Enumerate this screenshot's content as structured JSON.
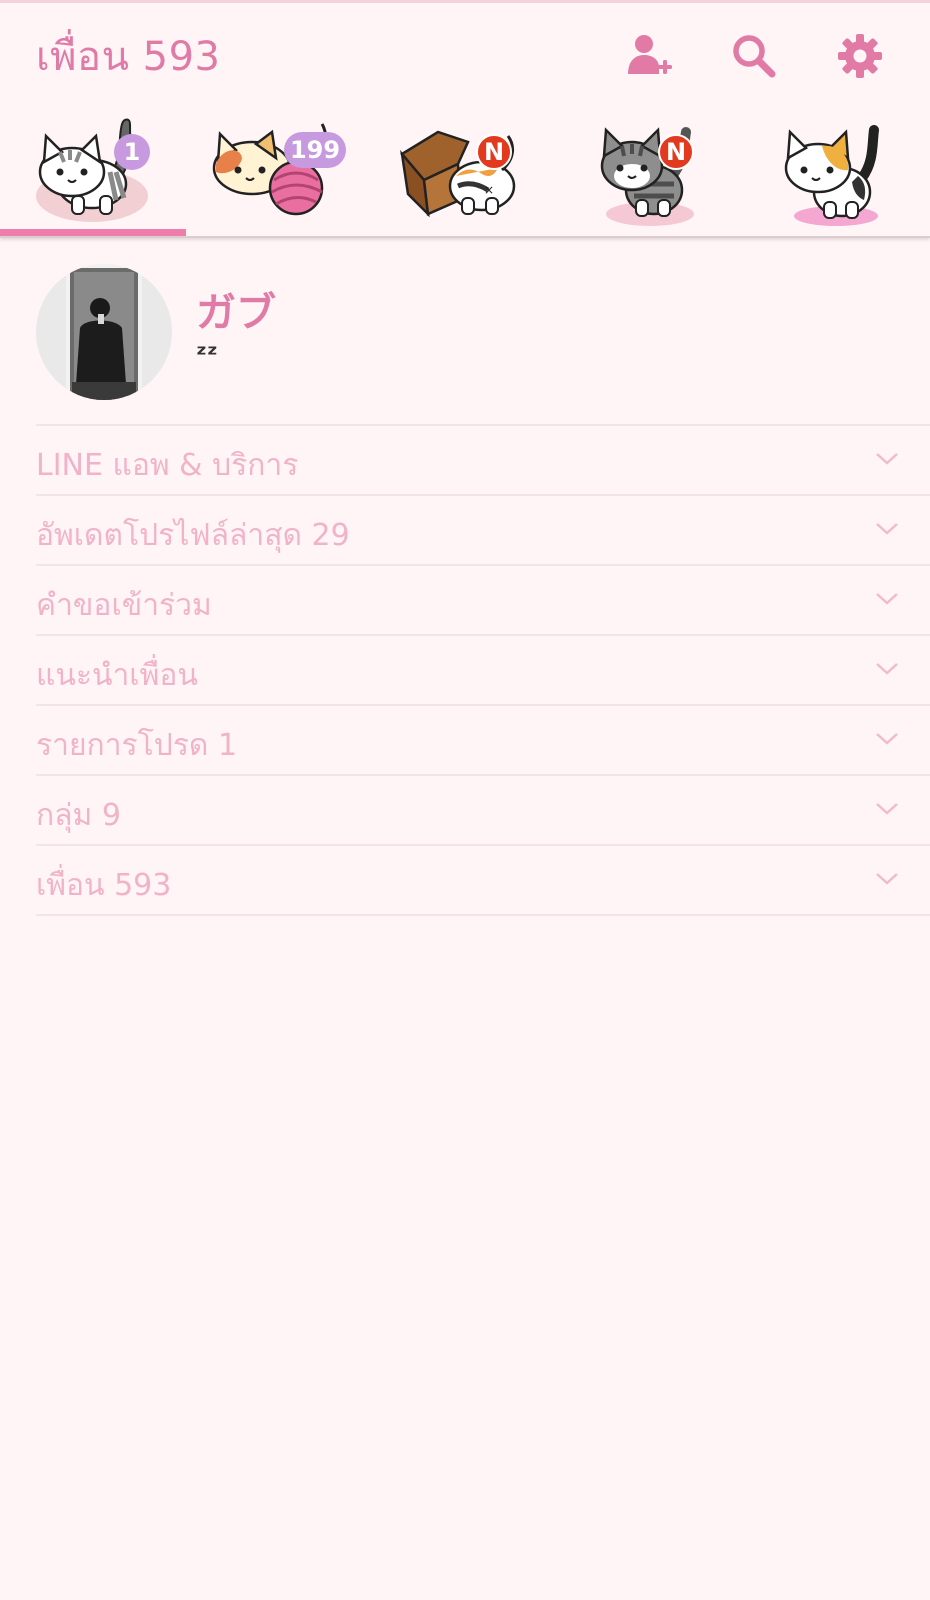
{
  "header": {
    "title": "เพื่อน 593",
    "icons": [
      "add-friend-icon",
      "search-icon",
      "settings-gear-icon"
    ],
    "accent_color": "#e07aa6"
  },
  "tabs": [
    {
      "icon": "white-gray-cat-icon",
      "badge": "1",
      "badge_type": "count",
      "active": true
    },
    {
      "icon": "cat-with-yarn-ball-icon",
      "badge": "199",
      "badge_type": "count",
      "active": false
    },
    {
      "icon": "cat-in-box-icon",
      "badge": "N",
      "badge_type": "new",
      "active": false
    },
    {
      "icon": "gray-tabby-cat-icon",
      "badge": "N",
      "badge_type": "new",
      "active": false
    },
    {
      "icon": "calico-cat-icon",
      "badge": "",
      "badge_type": "none",
      "active": false
    }
  ],
  "profile": {
    "name": "ガブ",
    "status": "ᶻᶻ"
  },
  "sections": [
    {
      "label": "LINE แอพ & บริการ"
    },
    {
      "label": "อัพเดตโปรไฟล์ล่าสุด 29"
    },
    {
      "label": "คำขอเข้าร่วม"
    },
    {
      "label": "แนะนำเพื่อน"
    },
    {
      "label": "รายการโปรด 1"
    },
    {
      "label": "กลุ่ม 9"
    },
    {
      "label": "เพื่อน 593"
    }
  ]
}
